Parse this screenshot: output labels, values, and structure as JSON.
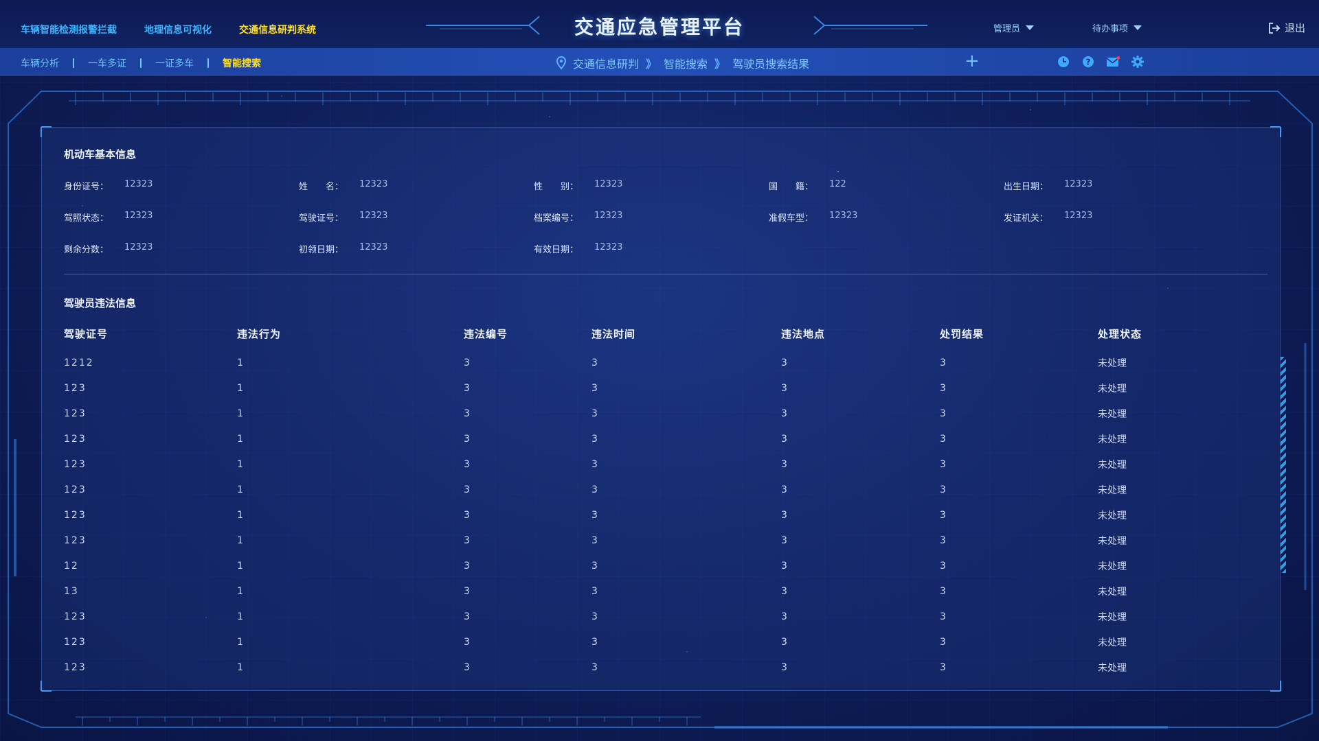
{
  "header": {
    "title": "交通应急管理平台",
    "nav": [
      {
        "label": "车辆智能检测报警拦截",
        "active": false
      },
      {
        "label": "地理信息可视化",
        "active": false
      },
      {
        "label": "交通信息研判系统",
        "active": true
      }
    ],
    "admin_menu": "管理员",
    "todo_menu": "待办事项",
    "logout": "退出"
  },
  "subnav": {
    "tabs": [
      {
        "label": "车辆分析",
        "active": false
      },
      {
        "label": "一车多证",
        "active": false
      },
      {
        "label": "一证多车",
        "active": false
      },
      {
        "label": "智能搜索",
        "active": true
      }
    ],
    "breadcrumb": [
      "交通信息研判",
      "智能搜索",
      "驾驶员搜索结果"
    ],
    "breadcrumb_sep": "》",
    "add_symbol": "+",
    "icons": [
      "clock-icon",
      "help-icon",
      "mail-icon",
      "settings-icon"
    ]
  },
  "basic_info": {
    "title": "机动车基本信息",
    "rows": [
      [
        {
          "label": "身份证号：",
          "value": "12323"
        },
        {
          "label": "姓　　名：",
          "value": "12323"
        },
        {
          "label": "性　　别：",
          "value": "12323"
        },
        {
          "label": "国　　籍：",
          "value": "122"
        },
        {
          "label": "出生日期：",
          "value": "12323"
        }
      ],
      [
        {
          "label": "驾照状态：",
          "value": "12323"
        },
        {
          "label": "驾驶证号：",
          "value": "12323"
        },
        {
          "label": "档案编号：",
          "value": "12323"
        },
        {
          "label": "准假车型：",
          "value": "12323"
        },
        {
          "label": "发证机关：",
          "value": "12323"
        }
      ],
      [
        {
          "label": "剩余分数：",
          "value": "12323"
        },
        {
          "label": "初领日期：",
          "value": "12323"
        },
        {
          "label": "有效日期：",
          "value": "12323"
        }
      ]
    ]
  },
  "violations": {
    "title": "驾驶员违法信息",
    "columns": [
      "驾驶证号",
      "违法行为",
      "违法编号",
      "违法时间",
      "违法地点",
      "处罚结果",
      "处理状态"
    ],
    "rows": [
      [
        "1212",
        "1",
        "3",
        "3",
        "3",
        "3",
        "未处理"
      ],
      [
        "123",
        "1",
        "3",
        "3",
        "3",
        "3",
        "未处理"
      ],
      [
        "123",
        "1",
        "3",
        "3",
        "3",
        "3",
        "未处理"
      ],
      [
        "123",
        "1",
        "3",
        "3",
        "3",
        "3",
        "未处理"
      ],
      [
        "123",
        "1",
        "3",
        "3",
        "3",
        "3",
        "未处理"
      ],
      [
        "123",
        "1",
        "3",
        "3",
        "3",
        "3",
        "未处理"
      ],
      [
        "123",
        "1",
        "3",
        "3",
        "3",
        "3",
        "未处理"
      ],
      [
        "123",
        "1",
        "3",
        "3",
        "3",
        "3",
        "未处理"
      ],
      [
        "12",
        "1",
        "3",
        "3",
        "3",
        "3",
        "未处理"
      ],
      [
        "13",
        "1",
        "3",
        "3",
        "3",
        "3",
        "未处理"
      ],
      [
        "123",
        "1",
        "3",
        "3",
        "3",
        "3",
        "未处理"
      ],
      [
        "123",
        "1",
        "3",
        "3",
        "3",
        "3",
        "未处理"
      ],
      [
        "123",
        "1",
        "3",
        "3",
        "3",
        "3",
        "未处理"
      ]
    ]
  },
  "colors": {
    "accent": "#ffe02a",
    "link": "#3fb4ff",
    "bg": "#0f1f5c"
  }
}
